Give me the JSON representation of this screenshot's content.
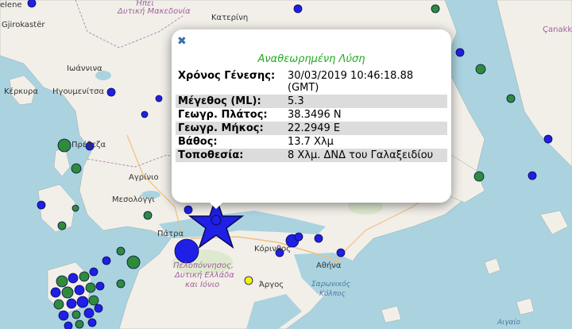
{
  "popup": {
    "close_icon": "close-x-icon",
    "title": "Αναθεωρημένη Λύση",
    "rows": [
      {
        "key": "Χρόνος Γένεσης:",
        "value": "30/03/2019 10:46:18.88 (GMT)"
      },
      {
        "key": "Μέγεθος (ML):",
        "value": "5.3"
      },
      {
        "key": "Γεωγρ. Πλάτος:",
        "value": "38.3496 N"
      },
      {
        "key": "Γεωγρ. Μήκος:",
        "value": "22.2949 E"
      },
      {
        "key": "Βάθος:",
        "value": "13.7 Χλμ"
      },
      {
        "key": "Τοποθεσία:",
        "value": "8 Χλμ. ΔΝΔ του Γαλαξειδίου"
      }
    ]
  },
  "labels": {
    "elene": "elene",
    "gjirokaster": "Gjirokastër",
    "ipiros": "Ήπει",
    "dytiki_makedonia": "Δυτική Μακεδονία",
    "katerini": "Κατερίνη",
    "ioannina": "Ιωάννινα",
    "kerkyra": "Κέρκυρα",
    "igoumenitsa": "Ηγουμενίτσα",
    "preveza": "Πρέβεζα",
    "agrinio": "Αγρίνιο",
    "mesologgi": "Μεσολόγγι",
    "patra": "Πάτρα",
    "korinthos": "Κόρινθος",
    "athina": "Αθήνα",
    "peloponnisos": "Πελοπόννησος,",
    "dytiki_ellada": "Δυτική Ελλάδα",
    "kai_ionio": "και Ιόνιο",
    "argos": "Άργος",
    "saronikos": "Σαρωνικός",
    "kolpos": "Κόλπος",
    "canakkale": "Çanakk",
    "aigaio": "Αιγαίο"
  },
  "colors": {
    "sea": "#aad3df",
    "land": "#f2efe9",
    "quake_blue": "#1f1fe6",
    "quake_green": "#2e8b3a",
    "quake_yellow": "#f5f500",
    "popup_title": "#22aa22"
  },
  "markers": {
    "main_event_icon": "star-icon",
    "main_event_magnitude": "5.3"
  }
}
